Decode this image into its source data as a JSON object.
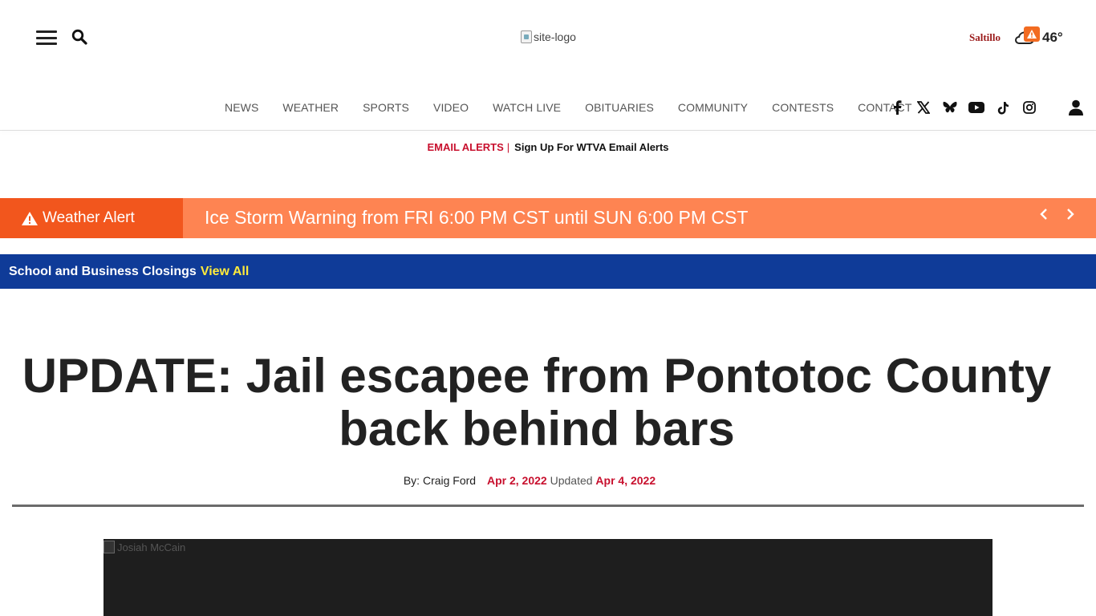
{
  "header": {
    "logo_alt": "site-logo",
    "location": "Saltillo",
    "temperature": "46°",
    "weather_icon": "cloud-alert-icon"
  },
  "nav": {
    "items": [
      "NEWS",
      "WEATHER",
      "SPORTS",
      "VIDEO",
      "WATCH LIVE",
      "OBITUARIES",
      "COMMUNITY",
      "CONTESTS",
      "CONTACT"
    ],
    "social_icons": [
      "facebook-icon",
      "x-icon",
      "bluesky-icon",
      "youtube-icon",
      "tiktok-icon",
      "instagram-icon"
    ]
  },
  "email_alerts": {
    "label": "EMAIL ALERTS",
    "separator": "|",
    "link": "Sign Up For WTVA Email Alerts"
  },
  "weather_alert": {
    "label": "Weather Alert",
    "text": "Ice Storm Warning from FRI 6:00 PM CST until SUN 6:00 PM CST",
    "label_color": "#f2561d",
    "bar_color": "#fe8452"
  },
  "closings": {
    "label": "School and Business Closings",
    "link": "View All",
    "bar_color": "#0f3b98"
  },
  "article": {
    "headline": "UPDATE: Jail escapee from Pontotoc County back behind bars",
    "author": "By: Craig Ford",
    "published": "Apr 2, 2022",
    "updated_label": "Updated",
    "updated": "Apr 4, 2022",
    "image_alt": "Josiah McCain"
  }
}
